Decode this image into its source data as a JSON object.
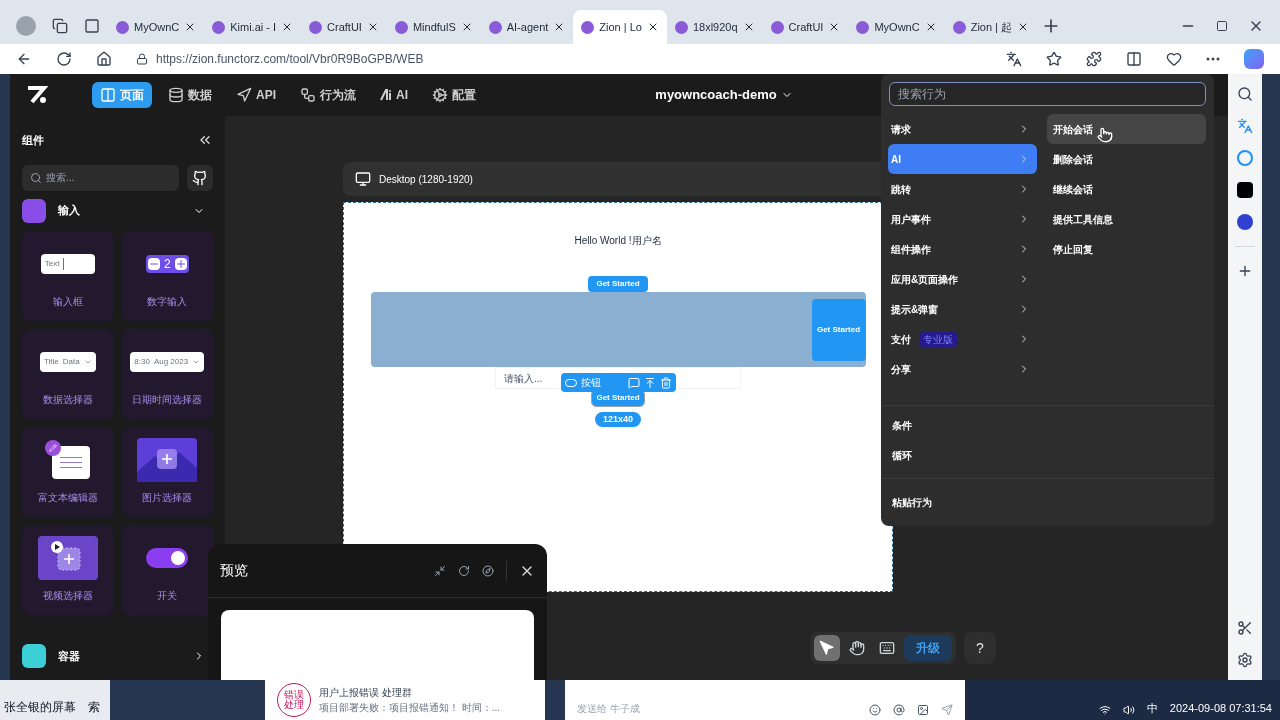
{
  "browser": {
    "tabs": [
      {
        "title": "MyOwnC",
        "selected": false
      },
      {
        "title": "Kimi.ai - I",
        "selected": false
      },
      {
        "title": "CraftUI",
        "selected": false
      },
      {
        "title": "MindfulS",
        "selected": false
      },
      {
        "title": "AI-agent",
        "selected": false
      },
      {
        "title": "Zion | Lo",
        "selected": true
      },
      {
        "title": "18xl920q",
        "selected": false
      },
      {
        "title": "CraftUI",
        "selected": false
      },
      {
        "title": "MyOwnC",
        "selected": false
      },
      {
        "title": "Zion | 起",
        "selected": false
      }
    ],
    "url": "https://zion.functorz.com/tool/Vbr0R9BoGPB/WEB"
  },
  "app": {
    "nav": [
      {
        "label": "页面",
        "kind": "page",
        "selected": true
      },
      {
        "label": "数据",
        "kind": "data",
        "selected": false
      },
      {
        "label": "API",
        "kind": "api",
        "selected": false
      },
      {
        "label": "行为流",
        "kind": "flow",
        "selected": false
      },
      {
        "label": "AI",
        "kind": "ai",
        "selected": false
      },
      {
        "label": "配置",
        "kind": "config",
        "selected": false
      }
    ],
    "project": "myowncoach-demo",
    "sidebar": {
      "title": "组件",
      "search_placeholder": "搜索...",
      "sections": [
        {
          "title": "输入",
          "kind": "input",
          "expanded": true,
          "items": [
            {
              "label": "输入框",
              "kind": "text-input",
              "sample": "Text"
            },
            {
              "label": "数字输入",
              "kind": "number-input",
              "sample": "2"
            },
            {
              "label": "数据选择器",
              "kind": "data-select",
              "sample": "Title",
              "sample2": "Data"
            },
            {
              "label": "日期时间选择器",
              "kind": "datetime",
              "sample": "8:30",
              "sample2": "Aug 2023"
            },
            {
              "label": "富文本编辑器",
              "kind": "rich-text"
            },
            {
              "label": "图片选择器",
              "kind": "image-picker"
            },
            {
              "label": "视频选择器",
              "kind": "video-picker"
            },
            {
              "label": "开关",
              "kind": "switch"
            }
          ]
        },
        {
          "title": "容器",
          "kind": "container",
          "expanded": false
        }
      ]
    },
    "canvas": {
      "device": "Desktop (1280-1920)",
      "hello": "Hello World !用户名",
      "button_top": "Get Started",
      "banner_button": "Get Started",
      "input_placeholder": "请输入...",
      "selected_button": "Get Started",
      "selection_label": "按钮",
      "size": "121x40"
    },
    "toolbar": {
      "tools": [
        {
          "kind": "select",
          "selected": true
        },
        {
          "kind": "hand",
          "selected": false
        },
        {
          "kind": "keyboard",
          "selected": false
        }
      ],
      "upgrade": "升级",
      "help": "?"
    },
    "preview": {
      "title": "预览"
    },
    "action_menu": {
      "search_placeholder": "搜索行为",
      "categories": [
        {
          "label": "请求",
          "selected": false
        },
        {
          "label": "AI",
          "selected": true
        },
        {
          "label": "跳转",
          "selected": false
        },
        {
          "label": "用户事件",
          "selected": false
        },
        {
          "label": "组件操作",
          "selected": false
        },
        {
          "label": "应用&页面操作",
          "selected": false
        },
        {
          "label": "提示&弹窗",
          "selected": false
        },
        {
          "label": "支付",
          "selected": false,
          "badge": "专业版"
        },
        {
          "label": "分享",
          "selected": false
        }
      ],
      "actions": [
        {
          "label": "开始会话",
          "hovered": true
        },
        {
          "label": "删除会话",
          "hovered": false
        },
        {
          "label": "继续会话",
          "hovered": false
        },
        {
          "label": "提供工具信息",
          "hovered": false
        },
        {
          "label": "停止回复",
          "hovered": false
        }
      ],
      "logic": [
        "条件",
        "循环"
      ],
      "paste": "粘贴行为"
    }
  },
  "desktop": {
    "screen_label": "张全银的屏幕",
    "search_fragment": "索",
    "chat": {
      "badge": "错误处理",
      "title": "用户上报错误 处理群",
      "message": "项目部署失败：项目报错通知！ 时间：...",
      "compose_placeholder": "发送给 牛子成"
    },
    "ime": "中",
    "clock": "2024-09-08 07:31:54"
  }
}
